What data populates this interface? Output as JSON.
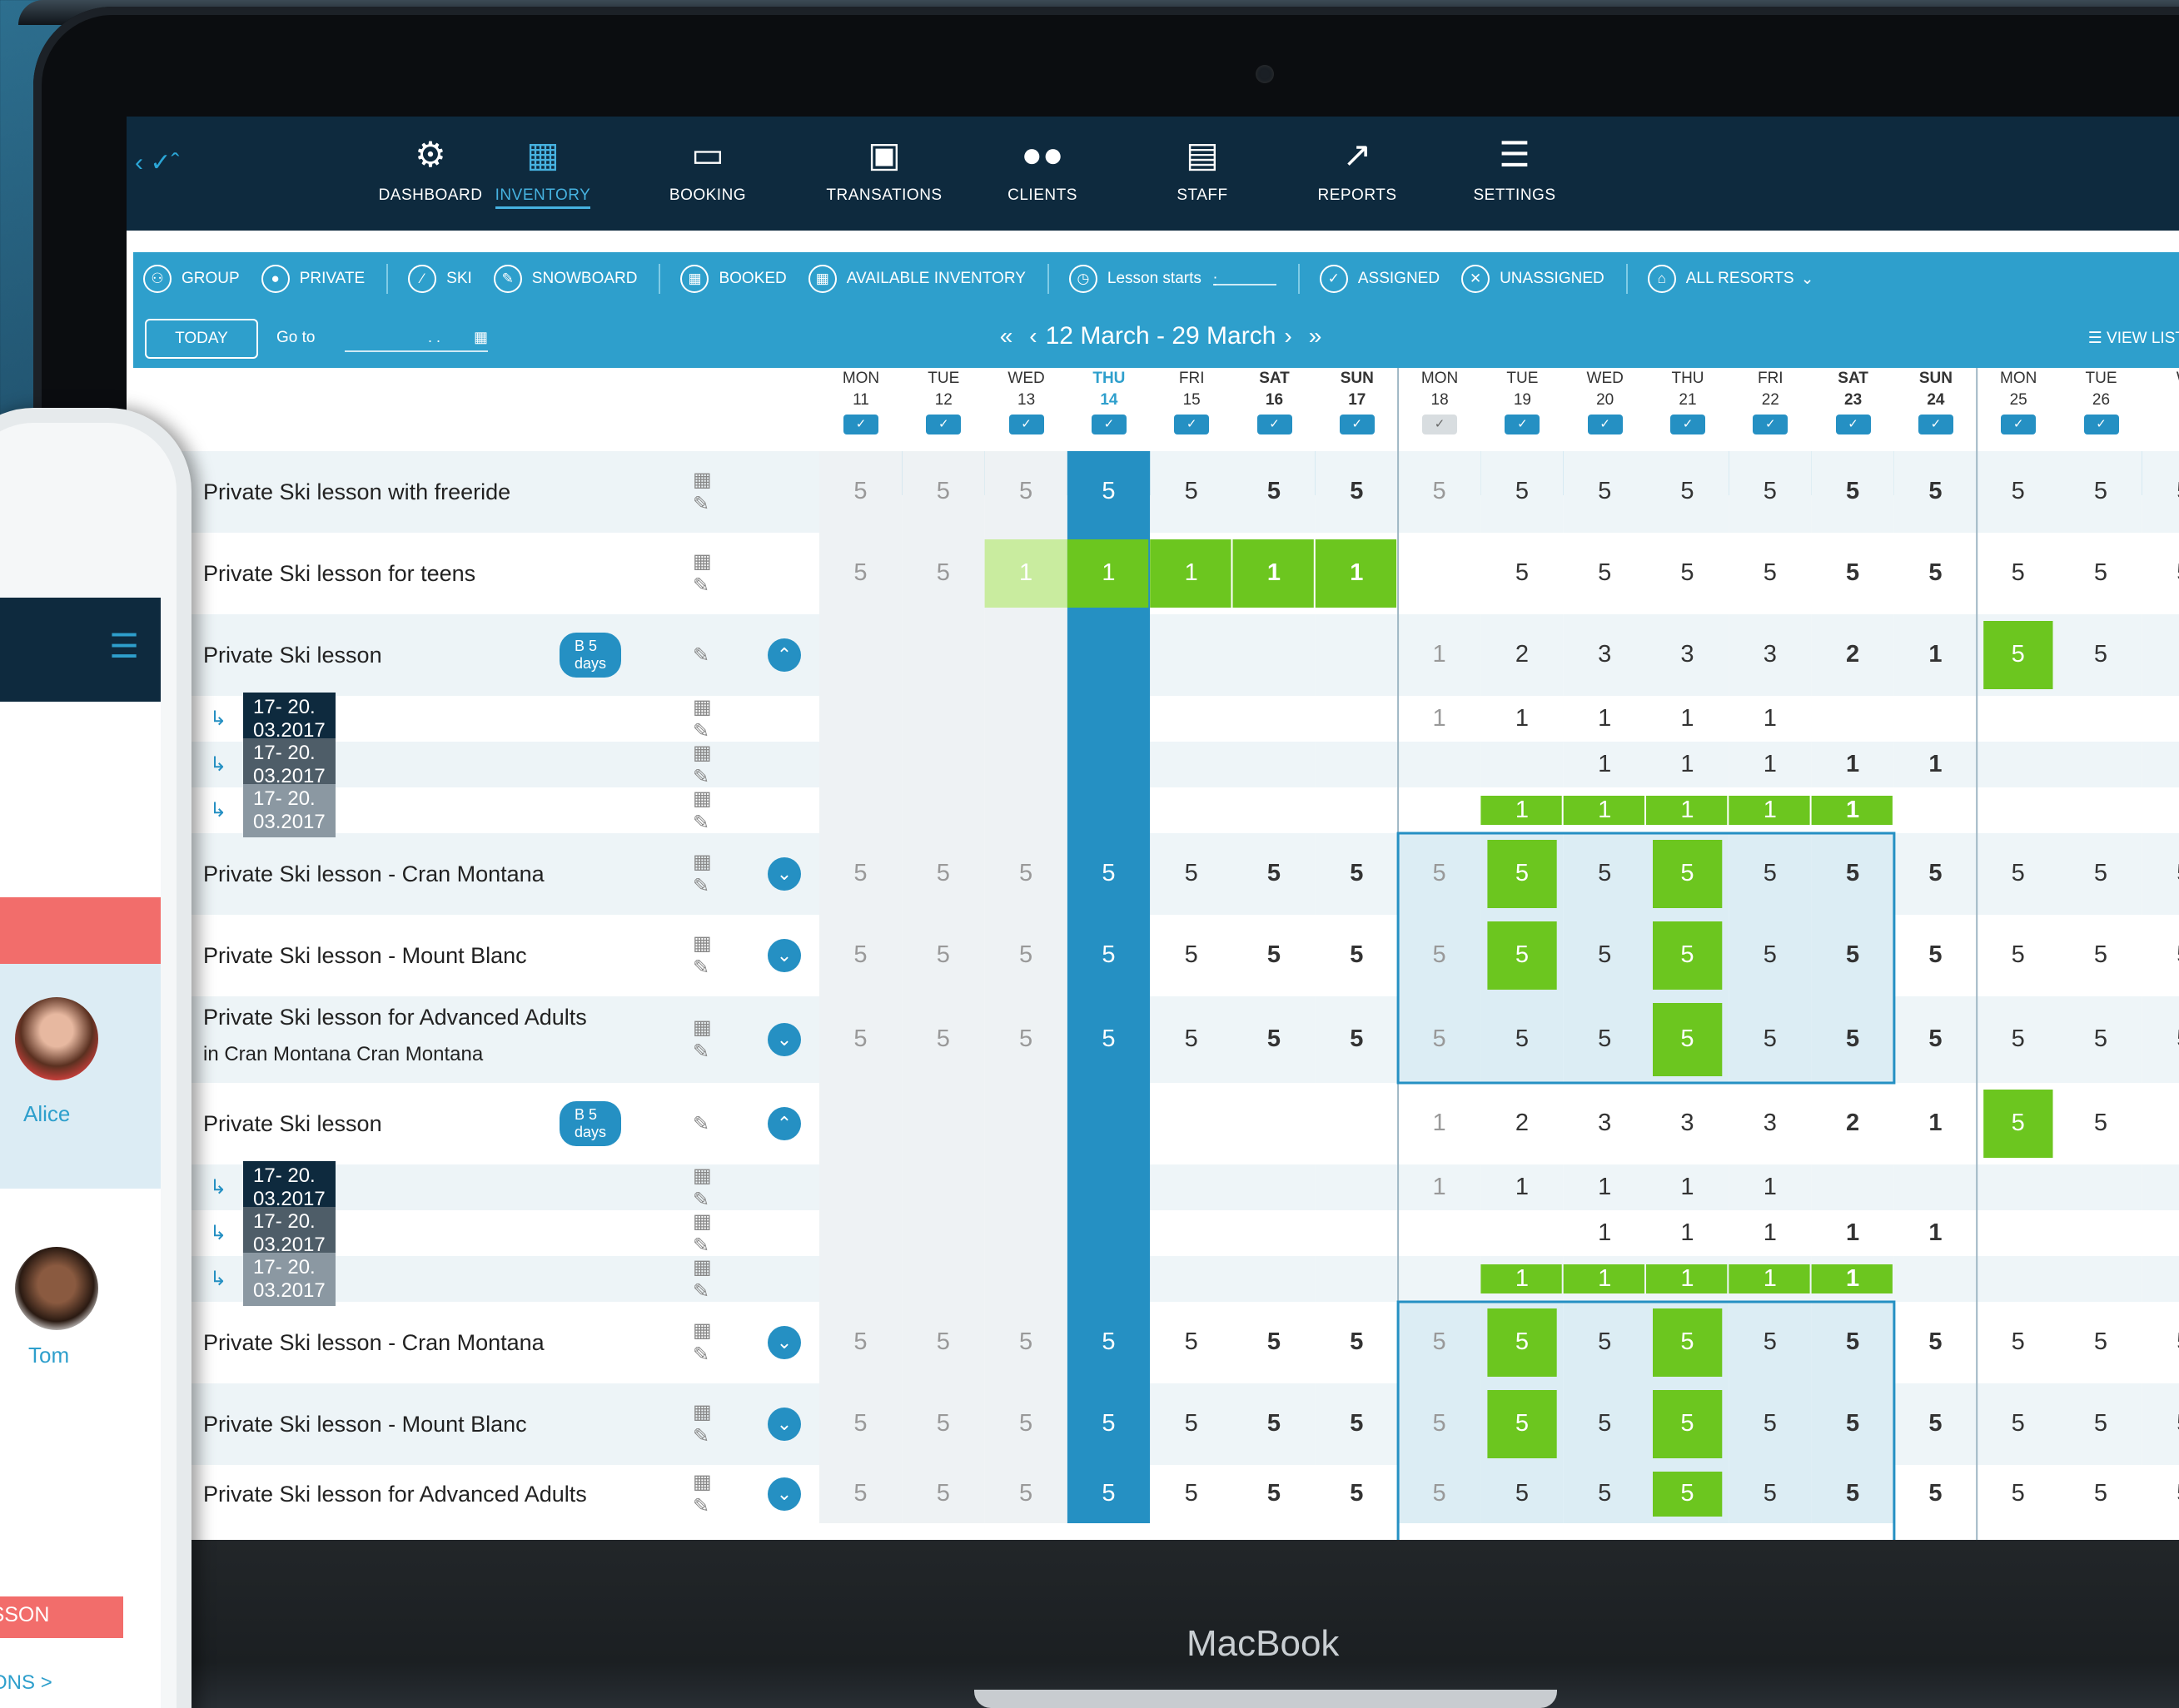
{
  "nav": {
    "items": [
      {
        "label": "DASHBOARD",
        "icon": "gears-icon"
      },
      {
        "label": "INVENTORY",
        "icon": "calendar-icon"
      },
      {
        "label": "BOOKING",
        "icon": "book-icon"
      },
      {
        "label": "TRANSATIONS",
        "icon": "money-icon"
      },
      {
        "label": "CLIENTS",
        "icon": "people-icon"
      },
      {
        "label": "STAFF",
        "icon": "id-card-icon"
      },
      {
        "label": "REPORTS",
        "icon": "chart-icon"
      },
      {
        "label": "SETTINGS",
        "icon": "sliders-icon"
      }
    ],
    "active": "INVENTORY"
  },
  "filters": {
    "group": "GROUP",
    "private": "PRIVATE",
    "ski": "SKI",
    "snowboard": "SNOWBOARD",
    "booked": "BOOKED",
    "available": "AVAILABLE INVENTORY",
    "lesson_starts": "Lesson starts",
    "lesson_starts_value": ":",
    "assigned": "ASSIGNED",
    "unassigned": "UNASSIGNED",
    "resorts": "ALL RESORTS"
  },
  "toolbar": {
    "today": "TODAY",
    "goto": "Go to",
    "goto_value": ". .",
    "range": "12 March - 29 March",
    "view_list": "VIEW LIST"
  },
  "days": [
    [
      "MON",
      "11"
    ],
    [
      "TUE",
      "12"
    ],
    [
      "WED",
      "13"
    ],
    [
      "THU",
      "14"
    ],
    [
      "FRI",
      "15"
    ],
    [
      "SAT",
      "16"
    ],
    [
      "SUN",
      "17"
    ],
    [
      "MON",
      "18"
    ],
    [
      "TUE",
      "19"
    ],
    [
      "WED",
      "20"
    ],
    [
      "THU",
      "21"
    ],
    [
      "FRI",
      "22"
    ],
    [
      "SAT",
      "23"
    ],
    [
      "SUN",
      "24"
    ],
    [
      "MON",
      "25"
    ],
    [
      "TUE",
      "26"
    ],
    [
      "W",
      ""
    ]
  ],
  "rows": [
    {
      "label": "Private Ski lesson with freeride",
      "vals": [
        "5",
        "5",
        "5",
        "5",
        "5",
        "5",
        "5",
        "5",
        "5",
        "5",
        "5",
        "5",
        "5",
        "5",
        "5",
        "5",
        "5"
      ]
    },
    {
      "label": "Private Ski lesson for teens",
      "vals": [
        "5",
        "5",
        "1",
        "1",
        "1",
        "1",
        "1",
        "",
        "5",
        "5",
        "5",
        "5",
        "5",
        "5",
        "5",
        "5",
        "5"
      ]
    },
    {
      "label": "Private Ski lesson",
      "badge": "B  5 days",
      "vals": [
        "",
        "",
        "",
        "",
        "",
        "",
        "",
        "1",
        "2",
        "3",
        "3",
        "3",
        "2",
        "1",
        "5",
        "5",
        ""
      ]
    },
    {
      "label": "Private Ski lesson - Cran Montana",
      "vals": [
        "5",
        "5",
        "5",
        "5",
        "5",
        "5",
        "5",
        "5",
        "5",
        "5",
        "5",
        "5",
        "5",
        "5",
        "5",
        "5",
        "5"
      ]
    },
    {
      "label": "Private Ski lesson - Mount Blanc",
      "vals": [
        "5",
        "5",
        "5",
        "5",
        "5",
        "5",
        "5",
        "5",
        "5",
        "5",
        "5",
        "5",
        "5",
        "5",
        "5",
        "5",
        "5"
      ]
    },
    {
      "label": "Private Ski lesson for Advanced Adults",
      "sub": "in  Cran Montana    Cran Montana",
      "vals": [
        "5",
        "5",
        "5",
        "5",
        "5",
        "5",
        "5",
        "5",
        "5",
        "5",
        "5",
        "5",
        "5",
        "5",
        "5",
        "5",
        "5"
      ]
    },
    {
      "label": "Private Ski lesson",
      "badge": "B  5 days",
      "vals": [
        "",
        "",
        "",
        "",
        "",
        "",
        "",
        "1",
        "2",
        "3",
        "3",
        "3",
        "2",
        "1",
        "5",
        "5",
        ""
      ]
    },
    {
      "label": "Private Ski lesson - Cran Montana",
      "vals": [
        "5",
        "5",
        "5",
        "5",
        "5",
        "5",
        "5",
        "5",
        "5",
        "5",
        "5",
        "5",
        "5",
        "5",
        "5",
        "5",
        "5"
      ]
    },
    {
      "label": "Private Ski lesson - Mount Blanc",
      "vals": [
        "5",
        "5",
        "5",
        "5",
        "5",
        "5",
        "5",
        "5",
        "5",
        "5",
        "5",
        "5",
        "5",
        "5",
        "5",
        "5",
        "5"
      ]
    },
    {
      "label": "Private Ski lesson for Advanced Adults",
      "vals": [
        "5",
        "5",
        "5",
        "5",
        "5",
        "5",
        "5",
        "5",
        "5",
        "5",
        "5",
        "5",
        "5",
        "5",
        "5",
        "5",
        "5"
      ]
    }
  ],
  "subrows": {
    "label": "17- 20. 03.2017",
    "a": [
      "",
      "",
      "",
      "",
      "",
      "",
      "",
      "1",
      "1",
      "1",
      "1",
      "1",
      "",
      "",
      "",
      "",
      ""
    ],
    "b": [
      "",
      "",
      "",
      "",
      "",
      "",
      "",
      "",
      "",
      "1",
      "1",
      "1",
      "1",
      "1",
      "",
      "",
      ""
    ],
    "c": [
      "",
      "",
      "",
      "",
      "",
      "",
      "",
      "",
      "1",
      "1",
      "1",
      "1",
      "1",
      "",
      "",
      "",
      ""
    ]
  },
  "phone": {
    "names": [
      "Alice",
      "Tom"
    ],
    "btn": "LESSON",
    "link": "SSONS  >"
  },
  "device": "MacBook",
  "colors": {
    "nav": "#0e2a3e",
    "accent": "#2e9fcc",
    "green": "#6cc61f"
  }
}
